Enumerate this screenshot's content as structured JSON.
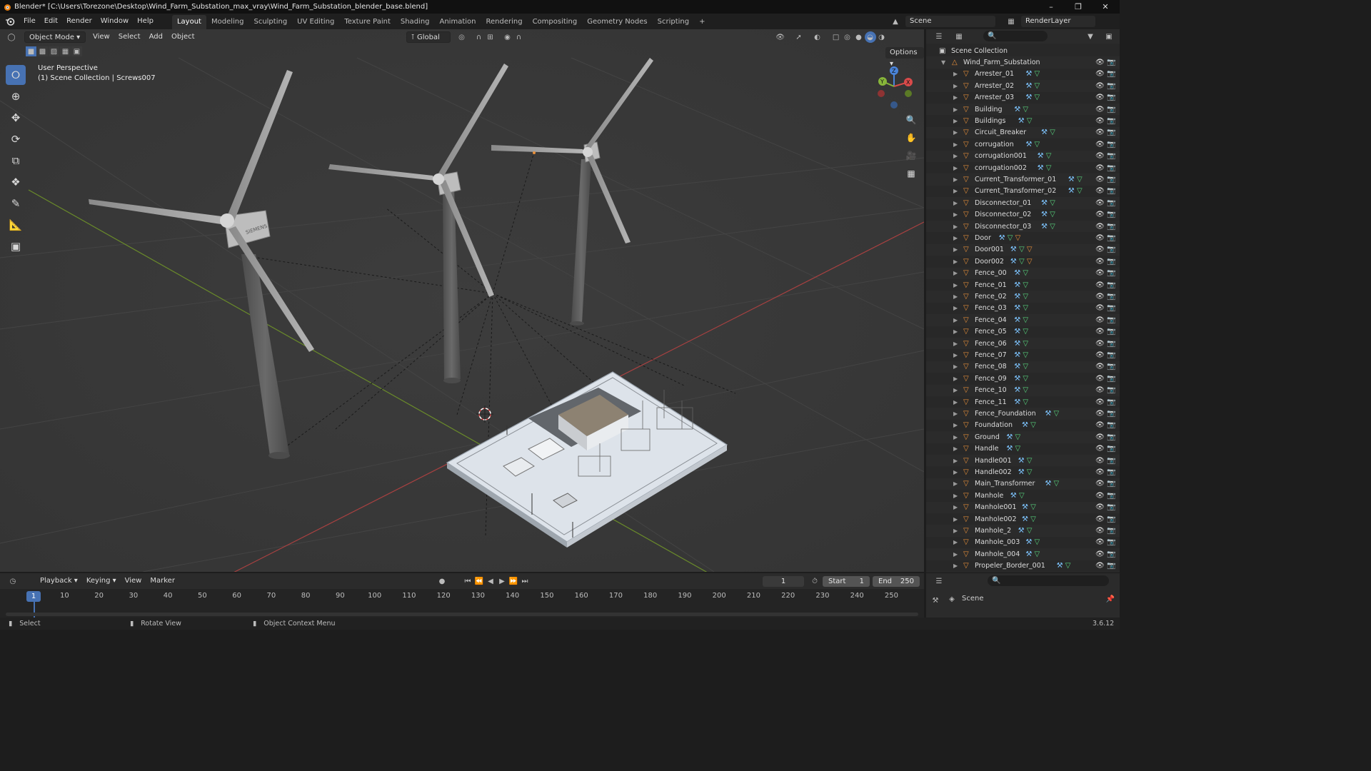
{
  "window": {
    "title": "Blender* [C:\\Users\\Torezone\\Desktop\\Wind_Farm_Substation_max_vray\\Wind_Farm_Substation_blender_base.blend]"
  },
  "menu": [
    "File",
    "Edit",
    "Render",
    "Window",
    "Help"
  ],
  "workspaces": [
    "Layout",
    "Modeling",
    "Sculpting",
    "UV Editing",
    "Texture Paint",
    "Shading",
    "Animation",
    "Rendering",
    "Compositing",
    "Geometry Nodes",
    "Scripting"
  ],
  "active_workspace": "Layout",
  "scene_name": "Scene",
  "view_layer": "RenderLayer",
  "viewport": {
    "mode": "Object Mode",
    "menus": [
      "View",
      "Select",
      "Add",
      "Object"
    ],
    "transform_orientation": "Global",
    "options_label": "Options",
    "overlay_line1": "User Perspective",
    "overlay_line2": "(1) Scene Collection | Screws007",
    "turbine_brand": "SIEMENS",
    "gizmo_axes": {
      "x": "X",
      "y": "Y",
      "z": "Z"
    }
  },
  "outliner": {
    "root": "Scene Collection",
    "collection": "Wind_Farm_Substation",
    "items": [
      {
        "name": "Arrester_01"
      },
      {
        "name": "Arrester_02"
      },
      {
        "name": "Arrester_03"
      },
      {
        "name": "Building"
      },
      {
        "name": "Buildings"
      },
      {
        "name": "Circuit_Breaker"
      },
      {
        "name": "corrugation"
      },
      {
        "name": "corrugation001"
      },
      {
        "name": "corrugation002"
      },
      {
        "name": "Current_Transformer_01"
      },
      {
        "name": "Current_Transformer_02"
      },
      {
        "name": "Disconnector_01"
      },
      {
        "name": "Disconnector_02"
      },
      {
        "name": "Disconnector_03"
      },
      {
        "name": "Door"
      },
      {
        "name": "Door001"
      },
      {
        "name": "Door002"
      },
      {
        "name": "Fence_00"
      },
      {
        "name": "Fence_01"
      },
      {
        "name": "Fence_02"
      },
      {
        "name": "Fence_03"
      },
      {
        "name": "Fence_04"
      },
      {
        "name": "Fence_05"
      },
      {
        "name": "Fence_06"
      },
      {
        "name": "Fence_07"
      },
      {
        "name": "Fence_08"
      },
      {
        "name": "Fence_09"
      },
      {
        "name": "Fence_10"
      },
      {
        "name": "Fence_11"
      },
      {
        "name": "Fence_Foundation"
      },
      {
        "name": "Foundation"
      },
      {
        "name": "Ground"
      },
      {
        "name": "Handle"
      },
      {
        "name": "Handle001"
      },
      {
        "name": "Handle002"
      },
      {
        "name": "Main_Transformer"
      },
      {
        "name": "Manhole"
      },
      {
        "name": "Manhole001"
      },
      {
        "name": "Manhole002"
      },
      {
        "name": "Manhole_2"
      },
      {
        "name": "Manhole_003"
      },
      {
        "name": "Manhole_004"
      },
      {
        "name": "Propeler_Border_001"
      }
    ]
  },
  "properties": {
    "scene_label": "Scene"
  },
  "timeline": {
    "menus": [
      "Playback",
      "Keying",
      "View",
      "Marker"
    ],
    "current_frame": "1",
    "start_label": "Start",
    "start": "1",
    "end_label": "End",
    "end": "250",
    "ruler": [
      "1",
      "10",
      "20",
      "30",
      "40",
      "50",
      "60",
      "70",
      "80",
      "90",
      "100",
      "110",
      "120",
      "130",
      "140",
      "150",
      "160",
      "170",
      "180",
      "190",
      "200",
      "210",
      "220",
      "230",
      "240",
      "250"
    ]
  },
  "statusbar": {
    "select": "Select",
    "rotate": "Rotate View",
    "context": "Object Context Menu",
    "version": "3.6.12"
  },
  "colors": {
    "accent": "#4772b3",
    "object_icon": "#e9903a",
    "x_axis": "#d94a4a",
    "y_axis": "#87b53a",
    "z_axis": "#4a84d9"
  }
}
